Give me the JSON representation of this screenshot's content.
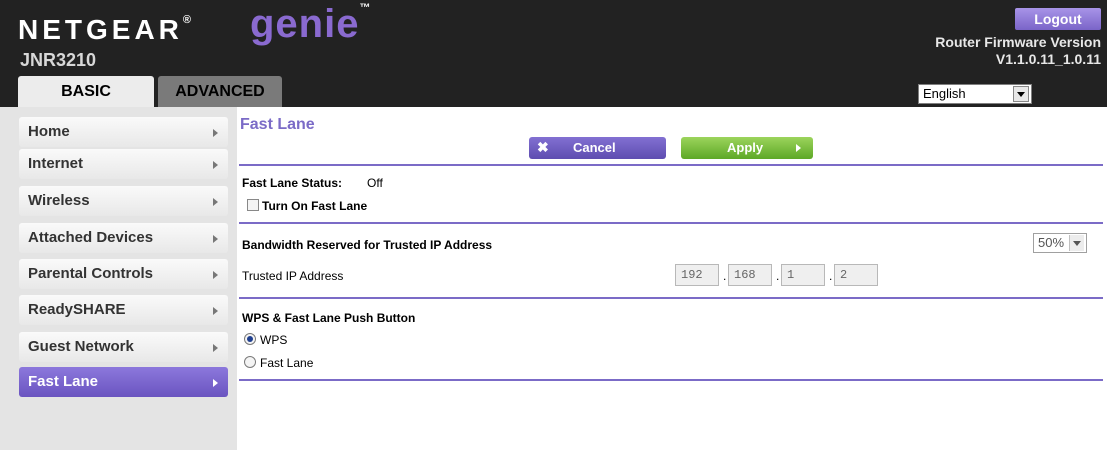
{
  "header": {
    "brand_name": "NETGEAR",
    "brand_reg": "®",
    "brand_product": "genie",
    "brand_tm": "™",
    "model": "JNR3210",
    "logout_label": "Logout",
    "firmware_label": "Router Firmware Version",
    "firmware_version": "V1.1.0.11_1.0.11",
    "tabs": [
      {
        "label": "BASIC",
        "active": true
      },
      {
        "label": "ADVANCED",
        "active": false
      }
    ],
    "language": "English"
  },
  "sidebar": {
    "items": [
      {
        "label": "Home"
      },
      {
        "label": "Internet"
      },
      {
        "label": "Wireless"
      },
      {
        "label": "Attached Devices"
      },
      {
        "label": "Parental Controls"
      },
      {
        "label": "ReadySHARE"
      },
      {
        "label": "Guest Network"
      },
      {
        "label": "Fast Lane",
        "active": true
      }
    ]
  },
  "main": {
    "title": "Fast Lane",
    "cancel_label": "Cancel",
    "apply_label": "Apply",
    "status_label": "Fast Lane Status:",
    "status_value": "Off",
    "turn_on_label": "Turn On Fast Lane",
    "turn_on_checked": false,
    "bandwidth_label": "Bandwidth Reserved for Trusted IP Address",
    "bandwidth_value": "50%",
    "trusted_ip_label": "Trusted IP Address",
    "trusted_ip": [
      "192",
      "168",
      "1",
      "2"
    ],
    "ip_separator": ".",
    "wps_section_label": "WPS & Fast Lane Push Button",
    "radio_options": [
      {
        "label": "WPS",
        "checked": true
      },
      {
        "label": "Fast Lane",
        "checked": false
      }
    ]
  },
  "colors": {
    "accent": "#7b6bc7",
    "header_bg": "#222222",
    "apply_green": "#6cb82e",
    "brand_purple": "#8a6ad0"
  },
  "icons": {
    "cancel": "close-icon",
    "apply": "triangle-right-icon",
    "nav": "triangle-right-icon",
    "dropdown": "chevron-down-icon"
  }
}
